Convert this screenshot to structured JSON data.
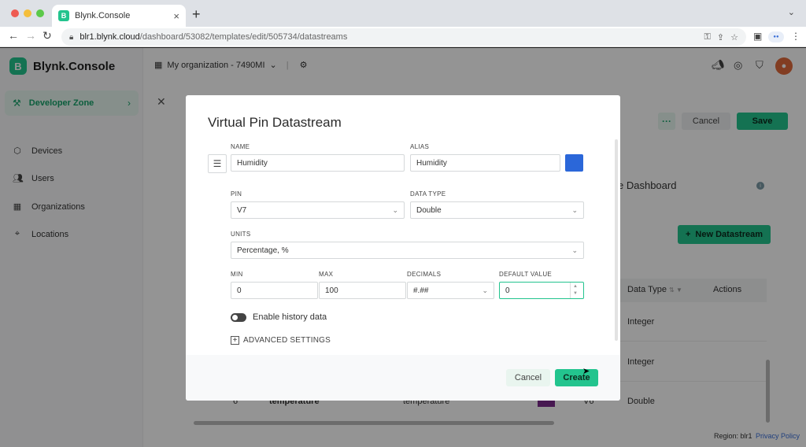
{
  "browser": {
    "tab_title": "Blynk.Console",
    "url_host": "blr1.blynk.cloud",
    "url_path": "/dashboard/53082/templates/edit/505734/datastreams"
  },
  "sidebar": {
    "brand": "Blynk.Console",
    "developer_zone": "Developer Zone",
    "items": [
      {
        "label": "Devices",
        "icon": "cube-icon"
      },
      {
        "label": "Users",
        "icon": "users-icon"
      },
      {
        "label": "Organizations",
        "icon": "building-icon"
      },
      {
        "label": "Locations",
        "icon": "pin-icon"
      }
    ]
  },
  "topbar": {
    "organization": "My organization - 7490MI"
  },
  "page": {
    "cancel_label": "Cancel",
    "save_label": "Save",
    "web_dashboard_label": "e Dashboard",
    "new_datastream_label": "New Datastream",
    "table": {
      "columns": [
        "Data Type",
        "Actions"
      ],
      "rows": [
        {
          "data_type": "Integer"
        },
        {
          "data_type": "Integer"
        },
        {
          "data_type": "Double"
        }
      ],
      "partial_row": {
        "id": "6",
        "name": "temperature",
        "alias": "temperature",
        "pin": "V6"
      }
    },
    "region": "Region: blr1",
    "privacy": "Privacy Policy"
  },
  "modal": {
    "title": "Virtual Pin Datastream",
    "name_label": "NAME",
    "name_value": "Humidity",
    "alias_label": "ALIAS",
    "alias_value": "Humidity",
    "color": "#2b67d9",
    "pin_label": "PIN",
    "pin_value": "V7",
    "data_type_label": "DATA TYPE",
    "data_type_value": "Double",
    "units_label": "UNITS",
    "units_value": "Percentage, %",
    "min_label": "MIN",
    "min_value": "0",
    "max_label": "MAX",
    "max_value": "100",
    "decimals_label": "DECIMALS",
    "decimals_value": "#.##",
    "default_label": "DEFAULT VALUE",
    "default_value": "0",
    "history_label": "Enable history data",
    "advanced_label": "ADVANCED SETTINGS",
    "cancel_label": "Cancel",
    "create_label": "Create"
  },
  "colors": {
    "accent": "#23c48e",
    "accent_text": "#16a36a"
  }
}
